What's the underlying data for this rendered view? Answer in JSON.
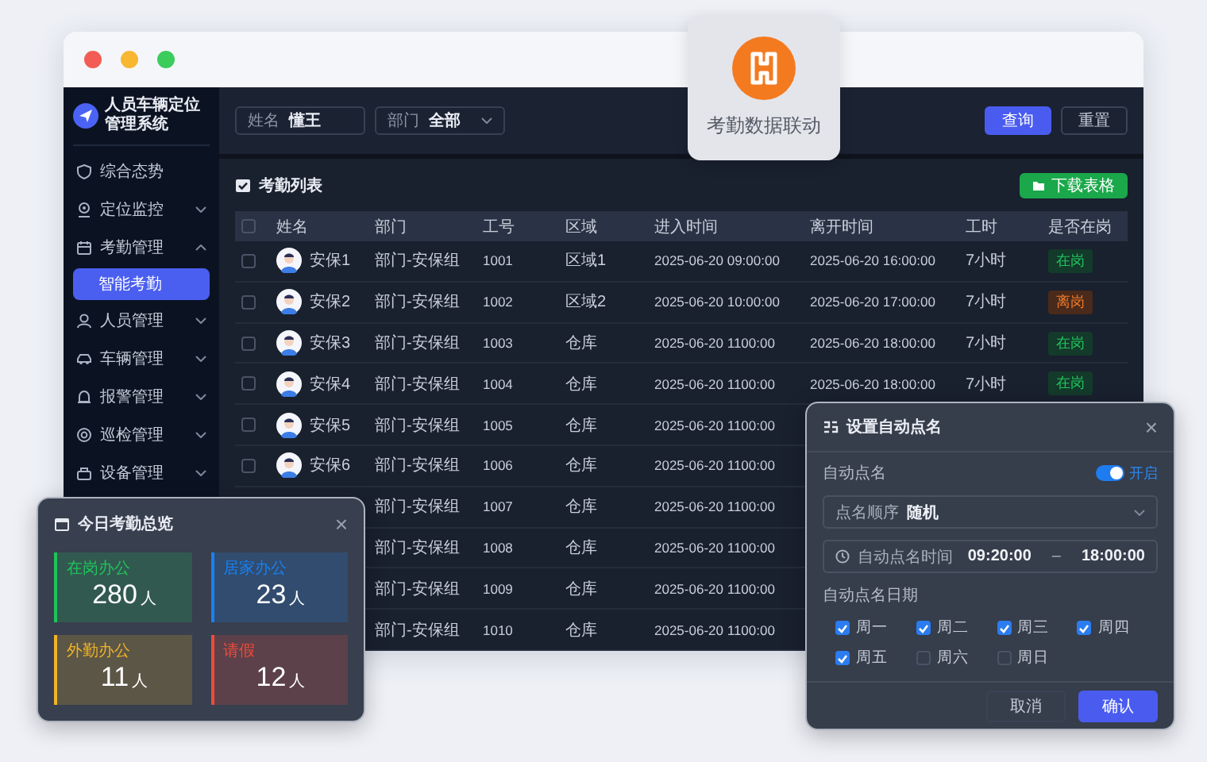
{
  "badge": {
    "label": "考勤数据联动"
  },
  "app": {
    "title": "人员车辆定位管理系统"
  },
  "sidebar": {
    "items": [
      {
        "label": "综合态势",
        "selected": false
      },
      {
        "label": "定位监控",
        "selected": false,
        "expanded": false
      },
      {
        "label": "考勤管理",
        "selected": false,
        "expanded": true,
        "children": [
          {
            "label": "智能考勤",
            "selected": true
          }
        ]
      },
      {
        "label": "人员管理",
        "selected": false,
        "expanded": false
      },
      {
        "label": "车辆管理",
        "selected": false,
        "expanded": false
      },
      {
        "label": "报警管理",
        "selected": false,
        "expanded": false
      },
      {
        "label": "巡检管理",
        "selected": false,
        "expanded": false
      },
      {
        "label": "设备管理",
        "selected": false,
        "expanded": false
      }
    ]
  },
  "filters": {
    "name": {
      "label": "姓名",
      "value": "懂王"
    },
    "department": {
      "label": "部门",
      "value": "全部"
    },
    "buttons": [
      "查询",
      "重置"
    ]
  },
  "list": {
    "title": "考勤列表",
    "download_button": "下载表格",
    "select_all": {
      "checked": false
    },
    "columns": [
      "姓名",
      "部门",
      "工号",
      "区域",
      "进入时间",
      "离开时间",
      "工时",
      "是否在岗"
    ],
    "rows": [
      {
        "selected": false,
        "name": "安保1",
        "department": "部门-安保组",
        "id": "1001",
        "area": "区域1",
        "enter": "2025-06-20 09:00:00",
        "leave": "2025-06-20 16:00:00",
        "hours": "7小时",
        "status": {
          "label": "在岗",
          "kind": "on"
        }
      },
      {
        "selected": false,
        "name": "安保2",
        "department": "部门-安保组",
        "id": "1002",
        "area": "区域2",
        "enter": "2025-06-20 10:00:00",
        "leave": "2025-06-20 17:00:00",
        "hours": "7小时",
        "status": {
          "label": "离岗",
          "kind": "off"
        }
      },
      {
        "selected": false,
        "name": "安保3",
        "department": "部门-安保组",
        "id": "1003",
        "area": "仓库",
        "enter": "2025-06-20 1100:00",
        "leave": "2025-06-20 18:00:00",
        "hours": "7小时",
        "status": {
          "label": "在岗",
          "kind": "on"
        }
      },
      {
        "selected": false,
        "name": "安保4",
        "department": "部门-安保组",
        "id": "1004",
        "area": "仓库",
        "enter": "2025-06-20 1100:00",
        "leave": "2025-06-20 18:00:00",
        "hours": "7小时",
        "status": {
          "label": "在岗",
          "kind": "on"
        }
      },
      {
        "selected": false,
        "name": "安保5",
        "department": "部门-安保组",
        "id": "1005",
        "area": "仓库",
        "enter": "2025-06-20 1100:00"
      },
      {
        "selected": false,
        "name": "安保6",
        "department": "部门-安保组",
        "id": "1006",
        "area": "仓库",
        "enter": "2025-06-20 1100:00"
      },
      {
        "department": "部门-安保组",
        "id": "1007",
        "area": "仓库",
        "enter": "2025-06-20 1100:00"
      },
      {
        "department": "部门-安保组",
        "id": "1008",
        "area": "仓库",
        "enter": "2025-06-20 1100:00"
      },
      {
        "department": "部门-安保组",
        "id": "1009",
        "area": "仓库",
        "enter": "2025-06-20 1100:00"
      },
      {
        "department": "部门-安保组",
        "id": "1010",
        "area": "仓库",
        "enter": "2025-06-20 1100:00"
      }
    ]
  },
  "overview": {
    "title": "今日考勤总览",
    "close": "×",
    "tiles": [
      {
        "label": "在岗办公",
        "count": "280",
        "unit": "人",
        "color": "#1ec45a"
      },
      {
        "label": "居家办公",
        "count": "23",
        "unit": "人",
        "color": "#1a80f0"
      },
      {
        "label": "外勤办公",
        "count": "11",
        "unit": "人",
        "color": "#f0b429"
      },
      {
        "label": "请假",
        "count": "12",
        "unit": "人",
        "color": "#f04a3a"
      }
    ]
  },
  "dialog": {
    "title": "设置自动点名",
    "close": "×",
    "auto_rollcall": {
      "label": "自动点名",
      "on": true,
      "state_label": "开启"
    },
    "order": {
      "label": "点名顺序",
      "value": "随机"
    },
    "time": {
      "label": "自动点名时间",
      "start": "09:20:00",
      "separator": "–",
      "end": "18:00:00"
    },
    "days_label": "自动点名日期",
    "days": [
      {
        "label": "周一",
        "checked": true
      },
      {
        "label": "周二",
        "checked": true
      },
      {
        "label": "周三",
        "checked": true
      },
      {
        "label": "周四",
        "checked": true
      },
      {
        "label": "周五",
        "checked": true
      },
      {
        "label": "周六",
        "checked": false
      },
      {
        "label": "周日",
        "checked": false
      }
    ],
    "buttons": [
      "取消",
      "确认"
    ]
  }
}
